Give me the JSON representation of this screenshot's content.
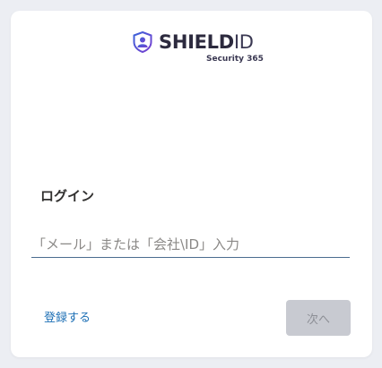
{
  "brand": {
    "name_strong": "SHIELD",
    "name_light": "ID",
    "subtitle": "Security 365"
  },
  "login": {
    "title": "ログイン",
    "input_placeholder": "「メール」または「会社\\ID」入力",
    "input_value": ""
  },
  "actions": {
    "register_label": "登録する",
    "next_label": "次へ",
    "next_disabled": true
  },
  "colors": {
    "page_background": "#eceef3",
    "card_background": "#ffffff",
    "logo_accent": "#5b3fd0",
    "input_underline": "#4a6c8f",
    "link": "#1c6fb5",
    "button_disabled_bg": "#c8cad1",
    "button_disabled_text": "#8d8f96"
  },
  "icons": {
    "logo": "shield-person-icon"
  }
}
